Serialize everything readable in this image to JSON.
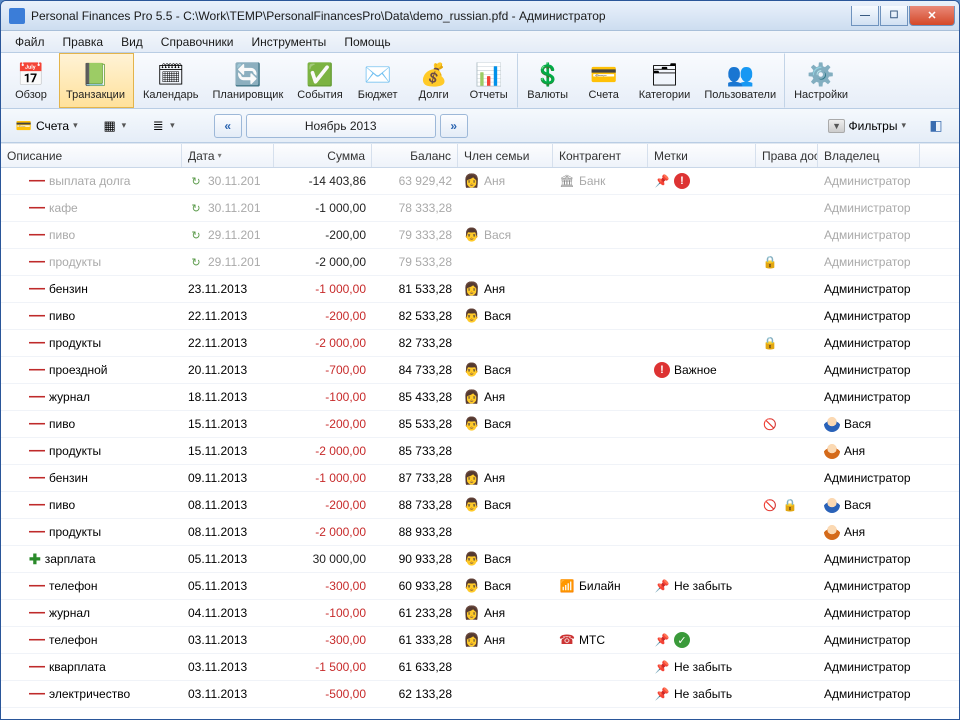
{
  "window": {
    "title": "Personal Finances Pro 5.5 - C:\\Work\\TEMP\\PersonalFinancesPro\\Data\\demo_russian.pfd - Администратор"
  },
  "menu": [
    "Файл",
    "Правка",
    "Вид",
    "Справочники",
    "Инструменты",
    "Помощь"
  ],
  "toolbar": [
    {
      "icon": "📅",
      "label": "Обзор",
      "name": "overview"
    },
    {
      "icon": "📗",
      "label": "Транзакции",
      "name": "transactions",
      "active": true,
      "sep": true
    },
    {
      "icon": "🗓",
      "label": "Календарь",
      "name": "calendar"
    },
    {
      "icon": "🔄",
      "label": "Планировщик",
      "name": "scheduler"
    },
    {
      "icon": "✅",
      "label": "События",
      "name": "events"
    },
    {
      "icon": "✉️",
      "label": "Бюджет",
      "name": "budget"
    },
    {
      "icon": "💰",
      "label": "Долги",
      "name": "debts"
    },
    {
      "icon": "📊",
      "label": "Отчеты",
      "name": "reports",
      "sep": true
    },
    {
      "icon": "💲",
      "label": "Валюты",
      "name": "currencies"
    },
    {
      "icon": "💳",
      "label": "Счета",
      "name": "accounts-ref"
    },
    {
      "icon": "🗂",
      "label": "Категории",
      "name": "categories"
    },
    {
      "icon": "👥",
      "label": "Пользователи",
      "name": "users",
      "sep": true
    },
    {
      "icon": "⚙️",
      "label": "Настройки",
      "name": "settings"
    }
  ],
  "subbar": {
    "accounts": "Счета",
    "period": "Ноябрь 2013",
    "filters": "Фильтры"
  },
  "columns": {
    "desc": "Описание",
    "date": "Дата",
    "sum": "Сумма",
    "bal": "Баланс",
    "fam": "Член семьи",
    "ctr": "Контрагент",
    "tag": "Метки",
    "acc": "Права дост",
    "own": "Владелец"
  },
  "rows": [
    {
      "f": true,
      "t": "-",
      "d": "выплата долга",
      "dt": "30.11.201",
      "s": "-14 403,86",
      "neg": false,
      "b": "63 929,42",
      "fam": "Аня",
      "famg": "f",
      "ctr": "Банк",
      "ctri": "bank",
      "tagi": [
        "pin",
        "excl"
      ],
      "own": "Администратор",
      "clk": true
    },
    {
      "f": true,
      "t": "-",
      "d": "кафе",
      "dt": "30.11.201",
      "s": "-1 000,00",
      "b": "78 333,28",
      "own": "Администратор",
      "clk": true
    },
    {
      "f": true,
      "t": "-",
      "d": "пиво",
      "dt": "29.11.201",
      "s": "-200,00",
      "b": "79 333,28",
      "fam": "Вася",
      "famg": "m",
      "own": "Администратор",
      "clk": true
    },
    {
      "f": true,
      "t": "-",
      "d": "продукты",
      "dt": "29.11.201",
      "s": "-2 000,00",
      "b": "79 533,28",
      "acci": [
        "lock"
      ],
      "own": "Администратор",
      "clk": true
    },
    {
      "t": "-",
      "d": "бензин",
      "dt": "23.11.2013",
      "s": "-1 000,00",
      "neg": true,
      "b": "81 533,28",
      "fam": "Аня",
      "famg": "f",
      "own": "Администратор"
    },
    {
      "t": "-",
      "d": "пиво",
      "dt": "22.11.2013",
      "s": "-200,00",
      "neg": true,
      "b": "82 533,28",
      "fam": "Вася",
      "famg": "m",
      "own": "Администратор"
    },
    {
      "t": "-",
      "d": "продукты",
      "dt": "22.11.2013",
      "s": "-2 000,00",
      "neg": true,
      "b": "82 733,28",
      "acci": [
        "lock"
      ],
      "own": "Администратор"
    },
    {
      "t": "-",
      "d": "проездной",
      "dt": "20.11.2013",
      "s": "-700,00",
      "neg": true,
      "b": "84 733,28",
      "fam": "Вася",
      "famg": "m",
      "tagi": [
        "excl"
      ],
      "tag": "Важное",
      "own": "Администратор"
    },
    {
      "t": "-",
      "d": "журнал",
      "dt": "18.11.2013",
      "s": "-100,00",
      "neg": true,
      "b": "85 433,28",
      "fam": "Аня",
      "famg": "f",
      "own": "Администратор"
    },
    {
      "t": "-",
      "d": "пиво",
      "dt": "15.11.2013",
      "s": "-200,00",
      "neg": true,
      "b": "85 533,28",
      "fam": "Вася",
      "famg": "m",
      "acci": [
        "eye"
      ],
      "own": "Вася",
      "ownav": "m"
    },
    {
      "t": "-",
      "d": "продукты",
      "dt": "15.11.2013",
      "s": "-2 000,00",
      "neg": true,
      "b": "85 733,28",
      "own": "Аня",
      "ownav": "f"
    },
    {
      "t": "-",
      "d": "бензин",
      "dt": "09.11.2013",
      "s": "-1 000,00",
      "neg": true,
      "b": "87 733,28",
      "fam": "Аня",
      "famg": "f",
      "own": "Администратор"
    },
    {
      "t": "-",
      "d": "пиво",
      "dt": "08.11.2013",
      "s": "-200,00",
      "neg": true,
      "b": "88 733,28",
      "fam": "Вася",
      "famg": "m",
      "acci": [
        "eye",
        "lock"
      ],
      "own": "Вася",
      "ownav": "m"
    },
    {
      "t": "-",
      "d": "продукты",
      "dt": "08.11.2013",
      "s": "-2 000,00",
      "neg": true,
      "b": "88 933,28",
      "own": "Аня",
      "ownav": "f"
    },
    {
      "t": "+",
      "d": "зарплата",
      "dt": "05.11.2013",
      "s": "30 000,00",
      "b": "90 933,28",
      "fam": "Вася",
      "famg": "m",
      "own": "Администратор"
    },
    {
      "t": "-",
      "d": "телефон",
      "dt": "05.11.2013",
      "s": "-300,00",
      "neg": true,
      "b": "60 933,28",
      "fam": "Вася",
      "famg": "m",
      "ctr": "Билайн",
      "ctri": "bars",
      "tagi": [
        "pin"
      ],
      "tag": "Не забыть",
      "own": "Администратор"
    },
    {
      "t": "-",
      "d": "журнал",
      "dt": "04.11.2013",
      "s": "-100,00",
      "neg": true,
      "b": "61 233,28",
      "fam": "Аня",
      "famg": "f",
      "own": "Администратор"
    },
    {
      "t": "-",
      "d": "телефон",
      "dt": "03.11.2013",
      "s": "-300,00",
      "neg": true,
      "b": "61 333,28",
      "fam": "Аня",
      "famg": "f",
      "ctr": "МТС",
      "ctri": "phone",
      "tagi": [
        "pin",
        "ok"
      ],
      "own": "Администратор"
    },
    {
      "t": "-",
      "d": "кварплата",
      "dt": "03.11.2013",
      "s": "-1 500,00",
      "neg": true,
      "b": "61 633,28",
      "tagi": [
        "pin"
      ],
      "tag": "Не забыть",
      "own": "Администратор"
    },
    {
      "t": "-",
      "d": "электричество",
      "dt": "03.11.2013",
      "s": "-500,00",
      "neg": true,
      "b": "62 133,28",
      "tagi": [
        "pin"
      ],
      "tag": "Не забыть",
      "own": "Администратор"
    }
  ]
}
